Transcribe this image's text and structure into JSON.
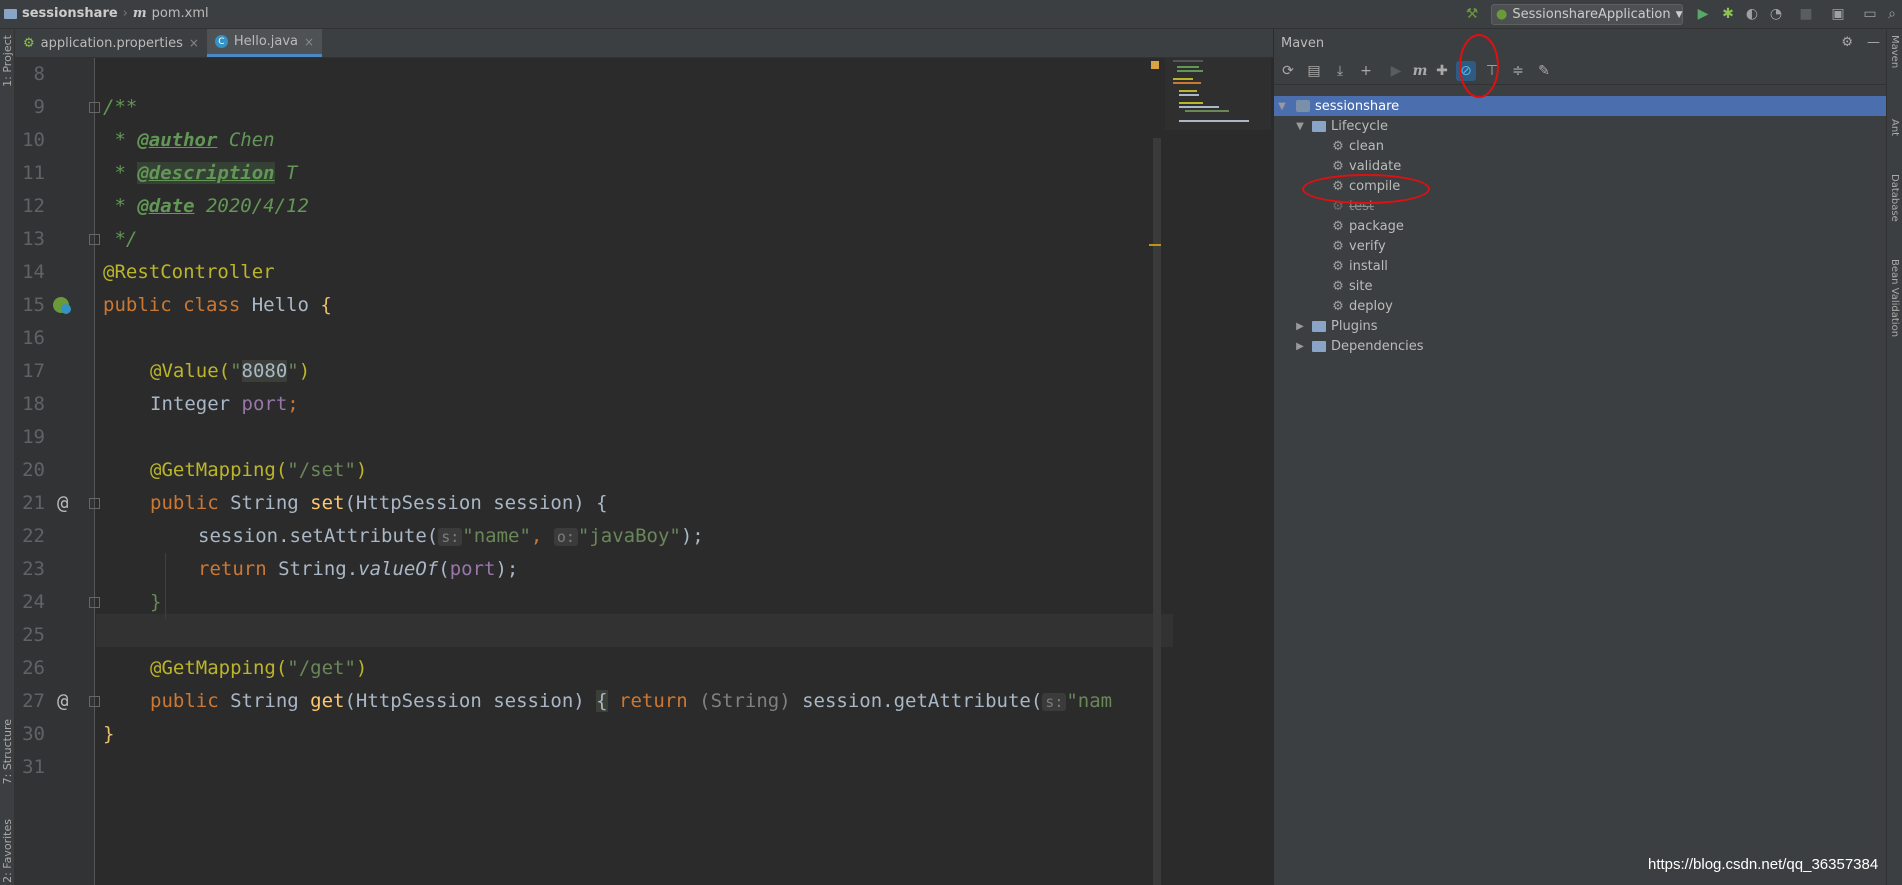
{
  "navbar": {
    "project": "sessionshare",
    "file": "pom.xml",
    "run_config": "SessionshareApplication"
  },
  "left_strip": {
    "project": "1: Project",
    "structure": "7: Structure",
    "favorites": "2: Favorites"
  },
  "right_strip": {
    "maven": "Maven",
    "ant": "Ant",
    "database": "Database",
    "bean_validation": "Bean Validation"
  },
  "tabs": [
    {
      "label": "application.properties",
      "active": false
    },
    {
      "label": "Hello.java",
      "active": true
    }
  ],
  "editor": {
    "line_numbers": [
      "8",
      "9",
      "10",
      "11",
      "12",
      "13",
      "14",
      "15",
      "16",
      "17",
      "18",
      "19",
      "20",
      "21",
      "22",
      "23",
      "24",
      "25",
      "26",
      "27",
      "30",
      "31"
    ],
    "code": {
      "l9": "/**",
      "l10_star": " * ",
      "l10_tag": "@author",
      "l10_val": " Chen",
      "l11_star": " * ",
      "l11_tag": "@description",
      "l11_val": " T",
      "l12_star": " * ",
      "l12_tag": "@date",
      "l12_val": " 2020/4/12",
      "l13": " */",
      "l14": "@RestController",
      "l15_kw": "public class ",
      "l15_name": "Hello ",
      "l15_brace": "{",
      "l17_ann": "@Value(",
      "l17_q1": "\"",
      "l17_val": "8080",
      "l17_q2": "\"",
      "l17_end": ")",
      "l18_type": "Integer ",
      "l18_field": "port",
      "l18_end": ";",
      "l20_ann": "@GetMapping(",
      "l20_str": "\"/set\"",
      "l20_end": ")",
      "l21_kw": "public ",
      "l21_type": "String ",
      "l21_name": "set",
      "l21_params": "(HttpSession session) {",
      "l22_call": "session.setAttribute(",
      "l22_hint1": "s:",
      "l22_str1": "\"name\"",
      "l22_comma": ", ",
      "l22_hint2": "o:",
      "l22_str2": "\"javaBoy\"",
      "l22_end": ");",
      "l23_kw": "return ",
      "l23_cls": "String.",
      "l23_method": "valueOf",
      "l23_open": "(",
      "l23_field": "port",
      "l23_end": ");",
      "l24": "}",
      "l26_ann": "@GetMapping(",
      "l26_str": "\"/get\"",
      "l26_end": ")",
      "l27_kw": "public ",
      "l27_type": "String ",
      "l27_name": "get",
      "l27_params": "(HttpSession session) ",
      "l27_brace": "{",
      "l27_ret": " return ",
      "l27_cast": "(String) ",
      "l27_call": "session.getAttribute(",
      "l27_hint": "s:",
      "l27_str": "\"nam",
      "l30": "}"
    },
    "gutter_marks": {
      "l21": "@",
      "l27": "@"
    }
  },
  "maven": {
    "title": "Maven",
    "root": "sessionshare",
    "lifecycle_label": "Lifecycle",
    "phases": [
      "clean",
      "validate",
      "compile",
      "test",
      "package",
      "verify",
      "install",
      "site",
      "deploy"
    ],
    "skipped_phase": "test",
    "plugins_label": "Plugins",
    "dependencies_label": "Dependencies",
    "toolbar_icons": [
      "reload-icon",
      "generate-sources-icon",
      "download-icon",
      "add-icon",
      "run-icon",
      "maven-goal-icon",
      "toggle-offline-icon",
      "skip-tests-icon",
      "show-dependencies-icon",
      "collapse-all-icon",
      "settings-wrench-icon"
    ]
  },
  "watermark": "https://blog.csdn.net/qq_36357384",
  "colors": {
    "annotation_red": "#e01010",
    "selection_blue": "#4b6eaf",
    "active_toggle": "#2f5a82"
  }
}
